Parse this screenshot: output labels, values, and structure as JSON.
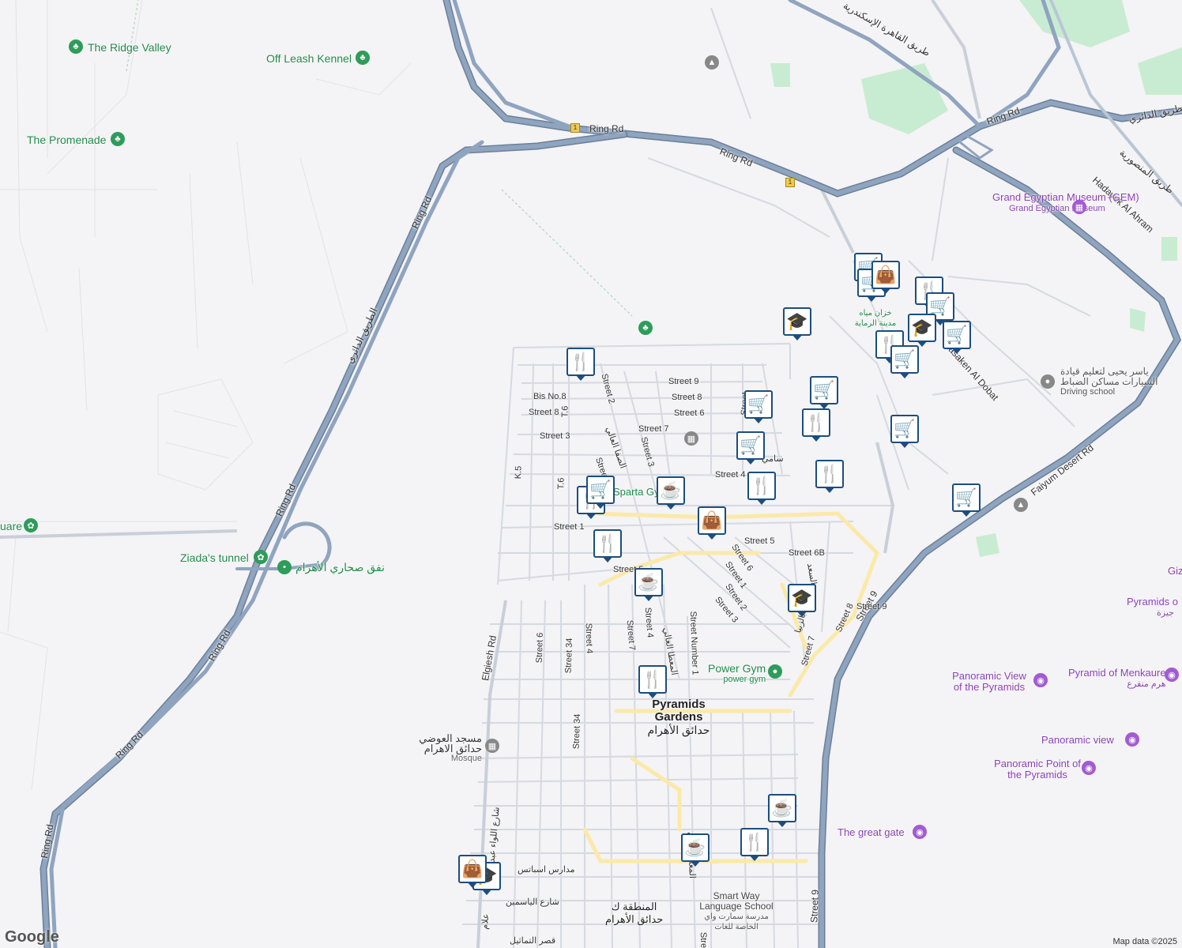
{
  "map": {
    "areas": [
      {
        "id": "pyramids-gardens",
        "name": "Pyramids Gardens",
        "name_ar": "حدائق الأهرام"
      },
      {
        "id": "area-k",
        "name": "المنطقة ك",
        "name_ar": "حدائق الأهرام"
      }
    ],
    "roads": [
      {
        "id": "ring-rd-top",
        "label": "Ring Rd"
      },
      {
        "id": "ring-rd-ne",
        "label": "Ring Rd"
      },
      {
        "id": "ring-rd-far-ne",
        "label": "Ring Rd"
      },
      {
        "id": "ring-rd-diag",
        "label": "Ring Rd"
      },
      {
        "id": "ring-rd-mid",
        "label": "Ring Rd"
      },
      {
        "id": "ring-rd-lower",
        "label": "Ring Rd"
      },
      {
        "id": "ring-rd-sw",
        "label": "Ring Rd"
      },
      {
        "id": "ring-rd-bottom",
        "label": "Ring Rd"
      },
      {
        "id": "ring-rd-ar",
        "label": "الطريق الدائري"
      },
      {
        "id": "alex-desert-rd",
        "label": "طريق القاهرة الإسكندرية"
      },
      {
        "id": "ring-ar-ne",
        "label": "الطريق الدائري"
      },
      {
        "id": "mansoureya-rd",
        "label": "طريق المنصورية"
      },
      {
        "id": "hadayek-ahram",
        "label": "Hadayek Al Ahram"
      },
      {
        "id": "faiyum-desert",
        "label": "Faiyum Desert Rd"
      },
      {
        "id": "masaken-dobat",
        "label": "Masaken Al Dobat"
      },
      {
        "id": "street-9-ne",
        "label": "Street 9"
      },
      {
        "id": "street-9-south",
        "label": "Street 9"
      },
      {
        "id": "elgiesh-rd",
        "label": "Elgiesh Rd"
      }
    ],
    "streets": [
      "Street 9",
      "Street 8",
      "Bis No.8",
      "Street 6",
      "Street 8",
      "Street 7",
      "Street 3",
      "Street 3",
      "Street 2",
      "Street 4",
      "Street 1",
      "Street 5",
      "Street 5",
      "Street 6B",
      "Street 6",
      "Street 1",
      "Street 2",
      "Street 3",
      "Street 8",
      "Street 7",
      "Street 6",
      "Street 34",
      "Street 4",
      "Street 7",
      "Street 4",
      "Street Number 1",
      "Street 34",
      "Street 9",
      "T.6",
      "K.5",
      "T.6",
      "الصفا العالي",
      "سامي",
      "المعطا العالي",
      "مدارس اسباتس",
      "شارع الياسمين",
      "قصر التماثيل",
      "المعطا الثاني",
      "شارع اللواء عبد",
      "علام",
      "السعد",
      "بالزبيا",
      "Stree",
      "Street",
      "Stre"
    ],
    "pois": [
      {
        "id": "ridge-valley",
        "name": "The Ridge Valley",
        "type": "park"
      },
      {
        "id": "off-leash",
        "name": "Off Leash Kennel",
        "type": "park"
      },
      {
        "id": "promenade",
        "name": "The Promenade",
        "type": "park"
      },
      {
        "id": "square",
        "name": "uare",
        "type": "park"
      },
      {
        "id": "ziada",
        "name": "Ziada's tunnel",
        "type": "park"
      },
      {
        "id": "nafaq",
        "name": "نفق صحاري الأهرام",
        "type": "park"
      },
      {
        "id": "gem",
        "name": "Grand Egyptian Museum (GEM)",
        "subtitle": "Grand Egyptian Museum",
        "type": "museum"
      },
      {
        "id": "driving",
        "name": "ياسر يحيى لتعليم قيادة السيارات مساكن الضباط",
        "subtitle": "Driving school",
        "type": "school"
      },
      {
        "id": "water-tank",
        "name": "خزان مياه مدينة الرماية",
        "type": "landmark"
      },
      {
        "id": "sparta",
        "name": "Sparta Gym",
        "type": "gym"
      },
      {
        "id": "power-gym",
        "name": "Power Gym",
        "subtitle": "power gym",
        "type": "gym"
      },
      {
        "id": "mosque",
        "name": "مسجد العوضي حدائق الاهرام",
        "subtitle": "Mosque",
        "type": "mosque"
      },
      {
        "id": "panoramic-view-pyr",
        "name": "Panoramic View of the Pyramids",
        "type": "attraction"
      },
      {
        "id": "menkaure",
        "name": "Pyramid of Menkaure",
        "subtitle": "هرم منقرع",
        "type": "attraction"
      },
      {
        "id": "panoramic-view",
        "name": "Panoramic view",
        "type": "attraction"
      },
      {
        "id": "panoramic-point",
        "name": "Panoramic Point of the Pyramids",
        "type": "attraction"
      },
      {
        "id": "great-gate",
        "name": "The great gate",
        "type": "attraction"
      },
      {
        "id": "pyramids-giza",
        "name": "Pyramids o",
        "subtitle": "جيزة",
        "type": "attraction"
      },
      {
        "id": "giza",
        "name": "Giz",
        "type": "attraction"
      },
      {
        "id": "smart-way",
        "name": "Smart Way Language School",
        "subtitle": "مدرسة سمارت واي الخاصة للغات",
        "type": "school"
      }
    ],
    "route_shields": [
      "1",
      "1"
    ],
    "markers": [
      {
        "type": "restaurant",
        "icon": "restaurant-icon"
      },
      {
        "type": "school",
        "icon": "school-icon"
      },
      {
        "type": "grocery",
        "icon": "grocery-icon"
      },
      {
        "type": "shop",
        "icon": "shopping-bag-icon"
      },
      {
        "type": "cafe",
        "icon": "cafe-icon"
      }
    ],
    "colors": {
      "background": "#f4f3f5",
      "highway": "#8fa4bf",
      "highway_edge": "#6b7f99",
      "street": "#d9dde5",
      "arterial": "#fbe9a9",
      "green": "#c8ecd1",
      "marker": "#1b4e7e"
    },
    "attribution": "Map data ©2025",
    "logo": "Google"
  }
}
